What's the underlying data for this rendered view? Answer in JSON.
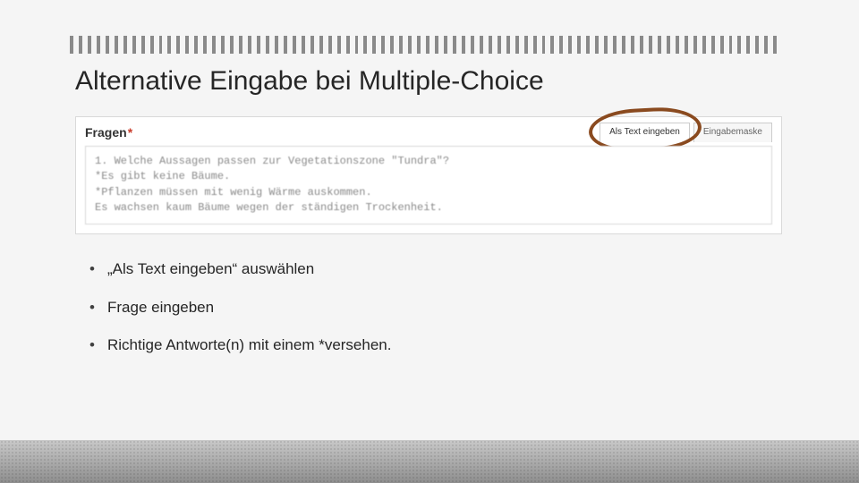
{
  "title": "Alternative Eingabe bei Multiple-Choice",
  "mock": {
    "label": "Fragen",
    "required_mark": "*",
    "tabs": {
      "active": "Als Text eingeben",
      "inactive": "Eingabemaske"
    },
    "text": "1. Welche Aussagen passen zur Vegetationszone \"Tundra\"?\n*Es gibt keine Bäume.\n*Pflanzen müssen mit wenig Wärme auskommen.\nEs wachsen kaum Bäume wegen der ständigen Trockenheit."
  },
  "bullets": {
    "b1": "„Als Text eingeben“ auswählen",
    "b2": "Frage eingeben",
    "b3": "Richtige Antworte(n) mit einem *versehen."
  }
}
